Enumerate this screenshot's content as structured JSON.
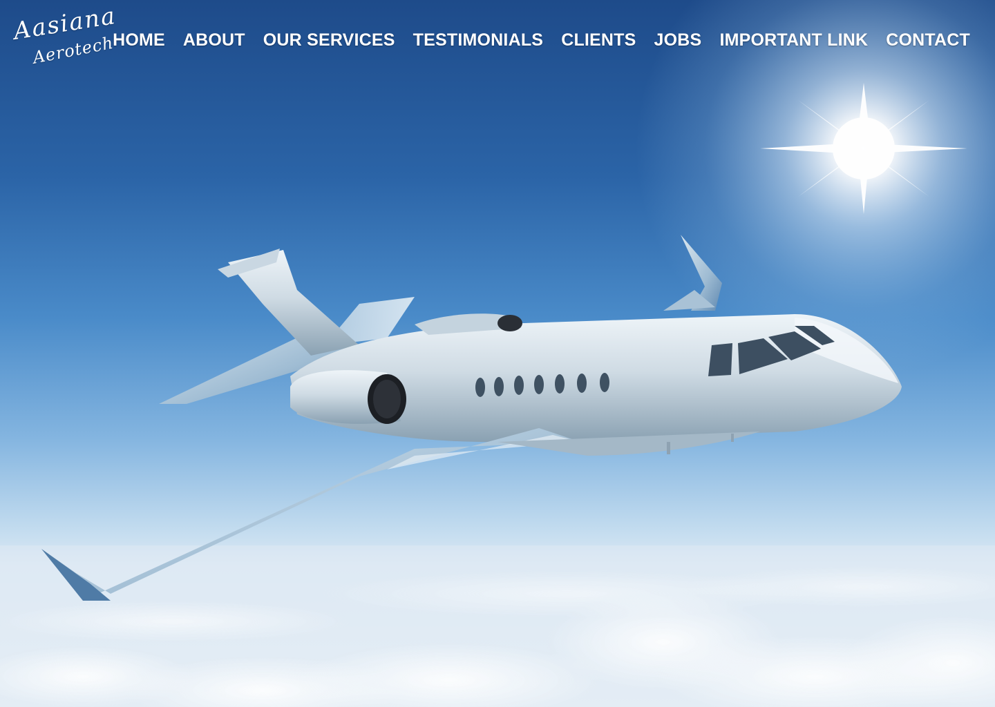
{
  "logo": {
    "line1": "Aasiana",
    "line2": "Aerotech"
  },
  "nav": {
    "items": [
      {
        "label": "HOME"
      },
      {
        "label": "ABOUT"
      },
      {
        "label": "OUR SERVICES"
      },
      {
        "label": "TESTIMONIALS"
      },
      {
        "label": "CLIENTS"
      },
      {
        "label": "JOBS"
      },
      {
        "label": "IMPORTANT LINK"
      },
      {
        "label": "CONTACT"
      }
    ]
  },
  "colors": {
    "sky_top": "#1f4f8f",
    "sky_mid": "#4a8ac8",
    "horizon": "#e8f0f6",
    "nav_text": "#ffffff"
  },
  "hero": {
    "image_icon": "private-jet-over-clouds"
  }
}
